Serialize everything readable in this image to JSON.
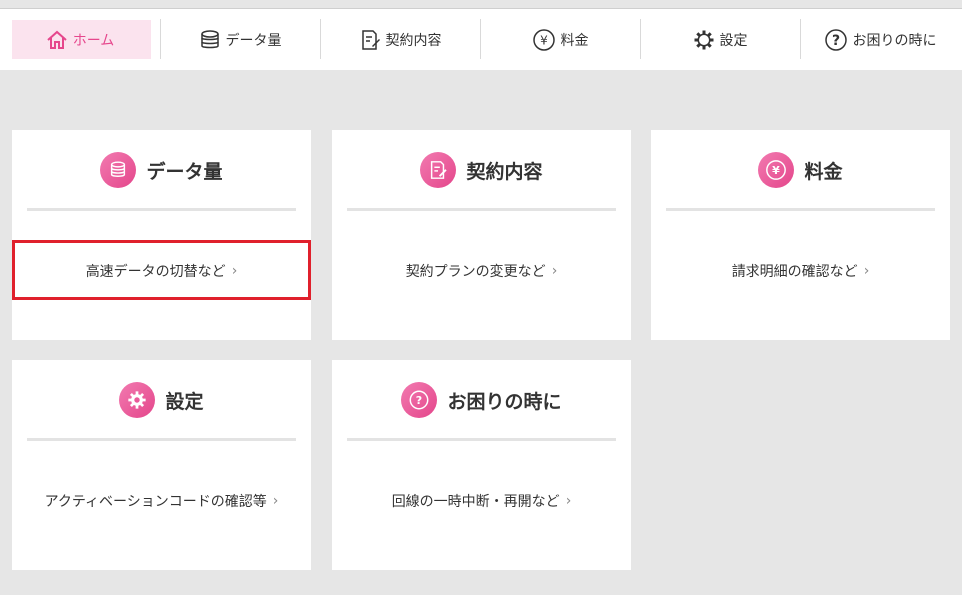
{
  "nav": {
    "items": [
      {
        "label": "ホーム",
        "icon": "home-icon",
        "active": true
      },
      {
        "label": "データ量",
        "icon": "database-icon"
      },
      {
        "label": "契約内容",
        "icon": "contract-icon"
      },
      {
        "label": "料金",
        "icon": "yen-icon"
      },
      {
        "label": "設定",
        "icon": "gear-icon"
      },
      {
        "label": "お困りの時に",
        "icon": "help-icon"
      }
    ]
  },
  "cards": [
    {
      "title": "データ量",
      "link": "高速データの切替など",
      "icon": "database-icon",
      "highlighted": true
    },
    {
      "title": "契約内容",
      "link": "契約プランの変更など",
      "icon": "contract-icon"
    },
    {
      "title": "料金",
      "link": "請求明細の確認など",
      "icon": "yen-icon"
    },
    {
      "title": "設定",
      "link": "アクティベーションコードの確認等",
      "icon": "gear-icon"
    },
    {
      "title": "お困りの時に",
      "link": "回線の一時中断・再開など",
      "icon": "help-icon"
    }
  ],
  "chevron": "›",
  "colors": {
    "accent": "#e6468c",
    "active_bg": "#fbe3ee",
    "highlight_border": "#e0202c",
    "background": "#e6e6e6"
  }
}
